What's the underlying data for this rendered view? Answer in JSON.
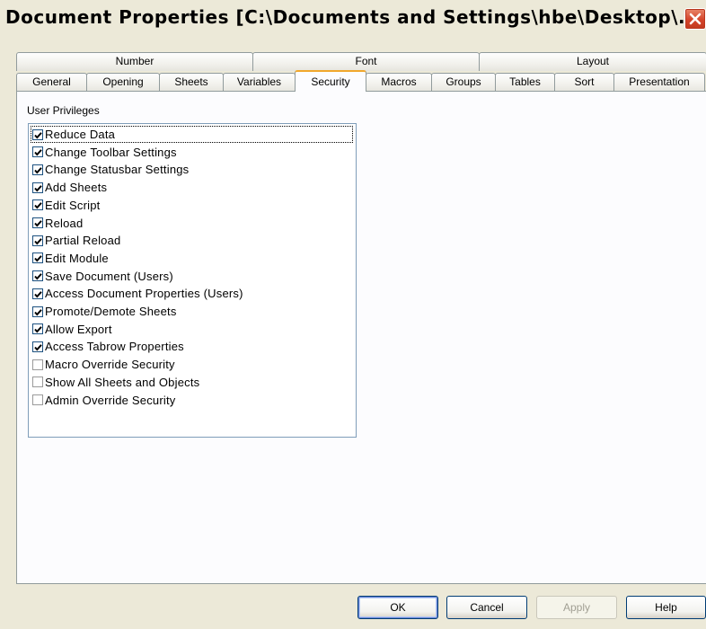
{
  "window": {
    "title": "Document Properties [C:\\Documents and Settings\\hbe\\Desktop\\..."
  },
  "tabs_top": [
    {
      "label": "Number"
    },
    {
      "label": "Font"
    },
    {
      "label": "Layout"
    }
  ],
  "tabs_bottom": [
    {
      "label": "General"
    },
    {
      "label": "Opening"
    },
    {
      "label": "Sheets"
    },
    {
      "label": "Variables"
    },
    {
      "label": "Security",
      "selected": true
    },
    {
      "label": "Macros"
    },
    {
      "label": "Groups"
    },
    {
      "label": "Tables"
    },
    {
      "label": "Sort"
    },
    {
      "label": "Presentation"
    }
  ],
  "security": {
    "group_label": "User Privileges",
    "privileges": [
      {
        "label": "Reduce Data",
        "checked": true
      },
      {
        "label": "Change Toolbar Settings",
        "checked": true
      },
      {
        "label": "Change Statusbar Settings",
        "checked": true
      },
      {
        "label": "Add Sheets",
        "checked": true
      },
      {
        "label": "Edit Script",
        "checked": true
      },
      {
        "label": "Reload",
        "checked": true
      },
      {
        "label": "Partial Reload",
        "checked": true
      },
      {
        "label": "Edit Module",
        "checked": true
      },
      {
        "label": "Save Document (Users)",
        "checked": true
      },
      {
        "label": "Access Document Properties (Users)",
        "checked": true
      },
      {
        "label": "Promote/Demote Sheets",
        "checked": true
      },
      {
        "label": "Allow Export",
        "checked": true
      },
      {
        "label": "Access Tabrow Properties",
        "checked": true
      },
      {
        "label": "Macro Override Security",
        "checked": false
      },
      {
        "label": "Show All Sheets and Objects",
        "checked": false
      },
      {
        "label": "Admin Override Security",
        "checked": false
      }
    ]
  },
  "buttons": {
    "ok": "OK",
    "cancel": "Cancel",
    "apply": "Apply",
    "help": "Help"
  },
  "icons": {
    "close": "close-icon",
    "checkbox_checked": "checkmark-icon"
  },
  "colors": {
    "dialog_bg": "#ece9d8",
    "panel_bg": "#fcfcfe",
    "selected_tab_accent": "#f1a72c",
    "close_button": "#d4442a"
  }
}
